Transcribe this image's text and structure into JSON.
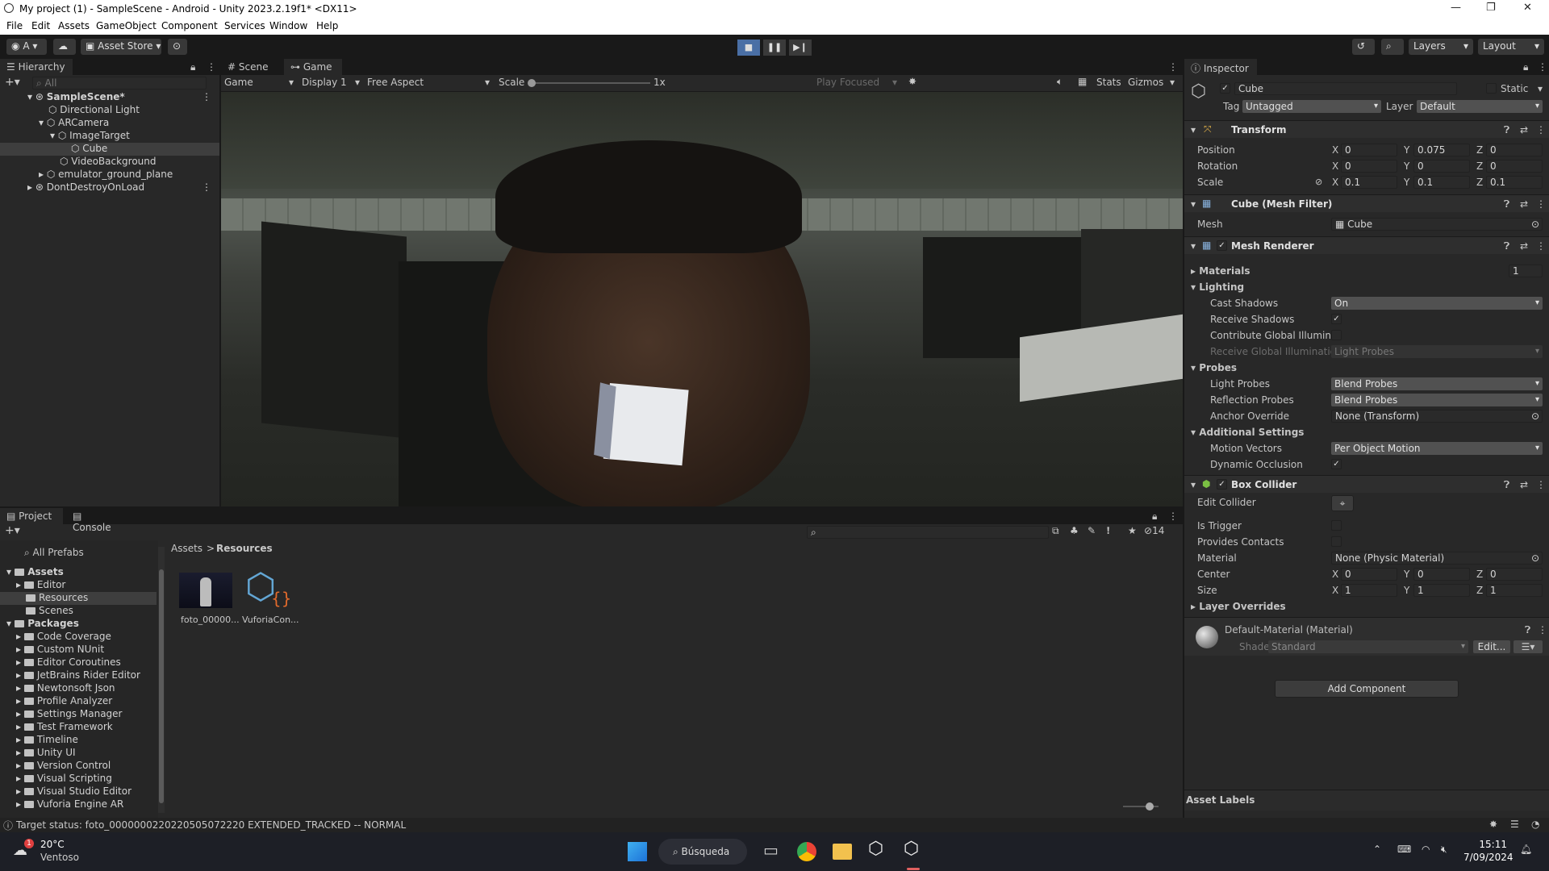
{
  "window": {
    "title": "My project (1) - SampleScene - Android - Unity 2023.2.19f1* <DX11>"
  },
  "menu": [
    "File",
    "Edit",
    "Assets",
    "GameObject",
    "Component",
    "Services",
    "Window",
    "Help"
  ],
  "toolbar": {
    "account": "A",
    "asset_store": "Asset Store",
    "layers": "Layers",
    "layout": "Layout"
  },
  "hierarchy": {
    "tab": "Hierarchy",
    "search_placeholder": "All",
    "items": [
      {
        "label": "SampleScene*"
      },
      {
        "label": "Directional Light"
      },
      {
        "label": "ARCamera"
      },
      {
        "label": "ImageTarget"
      },
      {
        "label": "Cube"
      },
      {
        "label": "VideoBackground"
      },
      {
        "label": "emulator_ground_plane"
      },
      {
        "label": "DontDestroyOnLoad"
      }
    ]
  },
  "view_tabs": {
    "scene": "Scene",
    "game": "Game"
  },
  "game_bar": {
    "mode": "Game",
    "display": "Display 1",
    "aspect": "Free Aspect",
    "scale_label": "Scale",
    "scale_value": "1x",
    "play_focused": "Play Focused",
    "stats": "Stats",
    "gizmos": "Gizmos"
  },
  "inspector": {
    "tab": "Inspector",
    "object_name": "Cube",
    "static": "Static",
    "tag_label": "Tag",
    "tag": "Untagged",
    "layer_label": "Layer",
    "layer": "Default",
    "transform": {
      "title": "Transform",
      "position_label": "Position",
      "position": {
        "x": "0",
        "y": "0.075",
        "z": "0"
      },
      "rotation_label": "Rotation",
      "rotation": {
        "x": "0",
        "y": "0",
        "z": "0"
      },
      "scale_label": "Scale",
      "scale": {
        "x": "0.1",
        "y": "0.1",
        "z": "0.1"
      }
    },
    "mesh_filter": {
      "title": "Cube (Mesh Filter)",
      "mesh_label": "Mesh",
      "mesh": "Cube"
    },
    "mesh_renderer": {
      "title": "Mesh Renderer",
      "materials_label": "Materials",
      "materials_count": "1",
      "lighting": "Lighting",
      "cast_shadows_label": "Cast Shadows",
      "cast_shadows": "On",
      "receive_shadows_label": "Receive Shadows",
      "contribute_gi_label": "Contribute Global Illuminat",
      "receive_gi_label": "Receive Global Illuminatior",
      "receive_gi": "Light Probes",
      "probes": "Probes",
      "light_probes_label": "Light Probes",
      "light_probes": "Blend Probes",
      "reflection_probes_label": "Reflection Probes",
      "reflection_probes": "Blend Probes",
      "anchor_override_label": "Anchor Override",
      "anchor_override": "None (Transform)",
      "additional": "Additional Settings",
      "motion_vectors_label": "Motion Vectors",
      "motion_vectors": "Per Object Motion",
      "dynamic_occlusion_label": "Dynamic Occlusion"
    },
    "box_collider": {
      "title": "Box Collider",
      "edit_collider": "Edit Collider",
      "is_trigger": "Is Trigger",
      "provides_contacts": "Provides Contacts",
      "material_label": "Material",
      "material": "None (Physic Material)",
      "center_label": "Center",
      "center": {
        "x": "0",
        "y": "0",
        "z": "0"
      },
      "size_label": "Size",
      "size": {
        "x": "1",
        "y": "1",
        "z": "1"
      }
    },
    "layer_overrides": "Layer Overrides",
    "material": {
      "name": "Default-Material (Material)",
      "shader_label": "Shader",
      "shader": "Standard",
      "edit": "Edit..."
    },
    "add_component": "Add Component",
    "asset_labels": "Asset Labels"
  },
  "project": {
    "tab_project": "Project",
    "tab_console": "Console",
    "hidden_count": "14",
    "all_prefabs": "All Prefabs",
    "breadcrumb": {
      "root": "Assets",
      "current": "Resources"
    },
    "tree": [
      {
        "label": "Assets",
        "bold": true,
        "indent": 0
      },
      {
        "label": "Editor",
        "indent": 1
      },
      {
        "label": "Resources",
        "indent": 1
      },
      {
        "label": "Scenes",
        "indent": 1
      },
      {
        "label": "Packages",
        "bold": true,
        "indent": 0
      },
      {
        "label": "Code Coverage",
        "indent": 1
      },
      {
        "label": "Custom NUnit",
        "indent": 1
      },
      {
        "label": "Editor Coroutines",
        "indent": 1
      },
      {
        "label": "JetBrains Rider Editor",
        "indent": 1
      },
      {
        "label": "Newtonsoft Json",
        "indent": 1
      },
      {
        "label": "Profile Analyzer",
        "indent": 1
      },
      {
        "label": "Settings Manager",
        "indent": 1
      },
      {
        "label": "Test Framework",
        "indent": 1
      },
      {
        "label": "Timeline",
        "indent": 1
      },
      {
        "label": "Unity UI",
        "indent": 1
      },
      {
        "label": "Version Control",
        "indent": 1
      },
      {
        "label": "Visual Scripting",
        "indent": 1
      },
      {
        "label": "Visual Studio Editor",
        "indent": 1
      },
      {
        "label": "Vuforia Engine AR",
        "indent": 1
      }
    ],
    "assets": [
      {
        "label": "foto_00000..."
      },
      {
        "label": "VuforiaCon..."
      }
    ]
  },
  "status": "Target status: foto_000000022022050507222­0 EXTENDED_TRACKED -- NORMAL",
  "taskbar": {
    "weather_temp": "20°C",
    "weather_desc": "Ventoso",
    "search": "Búsqueda",
    "time": "15:11",
    "date": "7/09/2024"
  },
  "colors": {
    "accent": "#3a79bb",
    "play_active": "#4a6fa5"
  }
}
